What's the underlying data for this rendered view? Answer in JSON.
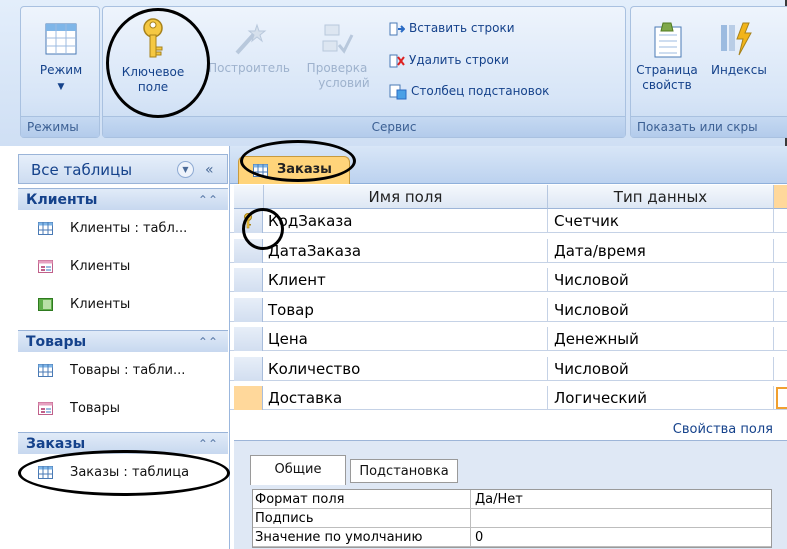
{
  "ribbon": {
    "groups": {
      "rezhimy": {
        "footer": "Режимы",
        "button": "Режим"
      },
      "servis": {
        "footer": "Сервис",
        "key_field": {
          "line1": "Ключевое",
          "line2": "поле"
        },
        "builder": "Построитель",
        "check": {
          "line1": "Проверка",
          "line2": "условий"
        },
        "insert_rows": "Вставить строки",
        "delete_rows": "Удалить строки",
        "lookup_column": "Столбец подстановок"
      },
      "show": {
        "footer": "Показать или скры",
        "property_sheet": {
          "line1": "Страница",
          "line2": "свойств"
        },
        "indexes": "Индексы"
      }
    }
  },
  "nav": {
    "header": "Все таблицы",
    "sections": [
      {
        "title": "Клиенты",
        "items": [
          "Клиенты : табл...",
          "Клиенты",
          "Клиенты"
        ]
      },
      {
        "title": "Товары",
        "items": [
          "Товары : табли...",
          "Товары"
        ]
      },
      {
        "title": "Заказы",
        "items": [
          "Заказы : таблица"
        ]
      }
    ]
  },
  "doc": {
    "tab": "Заказы",
    "columns": {
      "field_name": "Имя поля",
      "data_type": "Тип данных"
    },
    "rows": [
      {
        "name": "КодЗаказа",
        "type": "Счетчик",
        "key": true
      },
      {
        "name": "ДатаЗаказа",
        "type": "Дата/время"
      },
      {
        "name": "Клиент",
        "type": "Числовой"
      },
      {
        "name": "Товар",
        "type": "Числовой"
      },
      {
        "name": "Цена",
        "type": "Денежный"
      },
      {
        "name": "Количество",
        "type": "Числовой"
      },
      {
        "name": "Доставка",
        "type": "Логический",
        "selected": true
      }
    ],
    "properties_label": "Свойства поля",
    "property_tabs": [
      "Общие",
      "Подстановка"
    ],
    "properties": [
      {
        "key": "Формат поля",
        "value": "Да/Нет"
      },
      {
        "key": "Подпись",
        "value": ""
      },
      {
        "key": "Значение по умолчанию",
        "value": "0"
      }
    ]
  },
  "colors": {
    "accent": "#15428b",
    "tab": "#ffd47a",
    "selected_row": "#ffd89b"
  }
}
